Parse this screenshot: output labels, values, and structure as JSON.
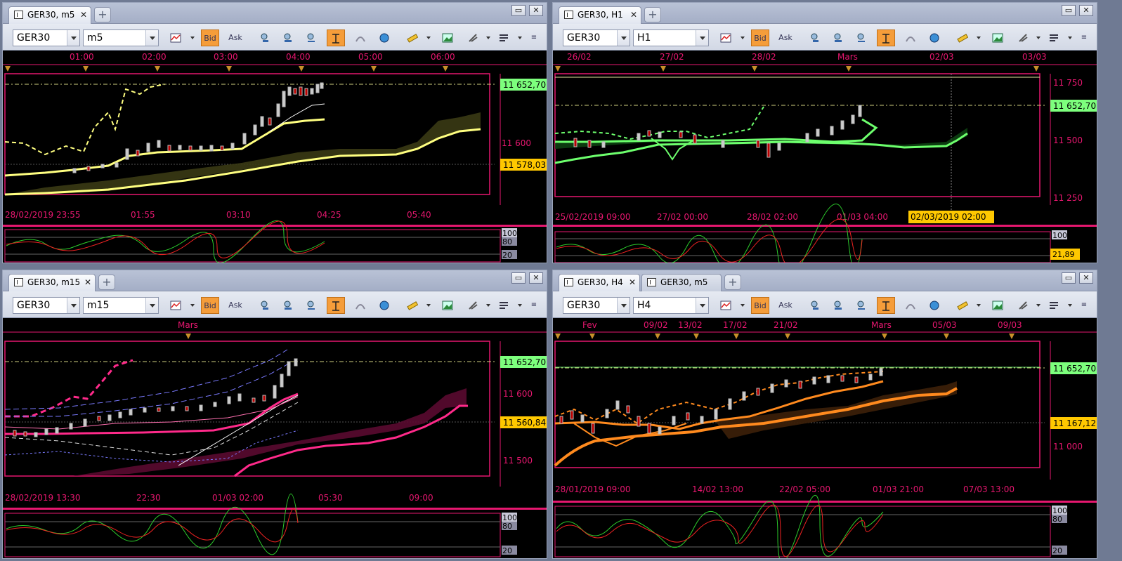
{
  "windows": [
    {
      "id": "w1",
      "tabs": [
        {
          "label": "GER30, m5",
          "active": true
        }
      ],
      "symbol": "GER30",
      "timeframe": "m5",
      "toolbar": {
        "bid": "Bid",
        "ask": "Ask"
      },
      "top_axis": [
        "01:00",
        "02:00",
        "03:00",
        "04:00",
        "05:00",
        "06:00"
      ],
      "price_labels": [
        "11 600"
      ],
      "badges": [
        {
          "text": "11 652,70",
          "color": "#7dff7d"
        },
        {
          "text": "11 578,03",
          "color": "#ffc800"
        }
      ],
      "bottom_axis": [
        "28/02/2019 23:55",
        "01:55",
        "03:10",
        "04:25",
        "05:40"
      ],
      "osc_labels": [
        "100",
        "80",
        "20"
      ]
    },
    {
      "id": "w2",
      "tabs": [
        {
          "label": "GER30, H1",
          "active": true
        }
      ],
      "symbol": "GER30",
      "timeframe": "H1",
      "toolbar": {
        "bid": "Bid",
        "ask": "Ask"
      },
      "top_axis": [
        "26/02",
        "27/02",
        "28/02",
        "Mars",
        "02/03",
        "03/03"
      ],
      "price_labels": [
        "11 750",
        "11 500",
        "11 250"
      ],
      "badges": [
        {
          "text": "11 652,70",
          "color": "#7dff7d"
        }
      ],
      "bottom_axis": [
        "25/02/2019 09:00",
        "27/02 00:00",
        "28/02 02:00",
        "01/03 04:00"
      ],
      "crosshair_label": "02/03/2019 02:00",
      "osc_labels": [
        "100"
      ],
      "osc_badge": "21,89"
    },
    {
      "id": "w3",
      "tabs": [
        {
          "label": "GER30, m15",
          "active": true
        }
      ],
      "symbol": "GER30",
      "timeframe": "m15",
      "toolbar": {
        "bid": "Bid",
        "ask": "Ask"
      },
      "top_axis": [
        "Mars"
      ],
      "price_labels": [
        "11 600",
        "11 500"
      ],
      "badges": [
        {
          "text": "11 652,70",
          "color": "#7dff7d"
        },
        {
          "text": "11 560,84",
          "color": "#ffc800"
        }
      ],
      "bottom_axis": [
        "28/02/2019 13:30",
        "22:30",
        "01/03 02:00",
        "05:30",
        "09:00"
      ],
      "osc_labels": [
        "100",
        "80",
        "20"
      ]
    },
    {
      "id": "w4",
      "tabs": [
        {
          "label": "GER30, H4",
          "active": true
        },
        {
          "label": "GER30, m5",
          "active": false
        }
      ],
      "symbol": "GER30",
      "timeframe": "H4",
      "toolbar": {
        "bid": "Bid",
        "ask": "Ask"
      },
      "top_axis": [
        "Fev",
        "09/02",
        "13/02",
        "17/02",
        "21/02",
        "Mars",
        "05/03",
        "09/03"
      ],
      "price_labels": [
        "11 000"
      ],
      "badges": [
        {
          "text": "11 652,70",
          "color": "#7dff7d"
        },
        {
          "text": "11 167,12",
          "color": "#ffc800"
        }
      ],
      "bottom_axis": [
        "28/01/2019 09:00",
        "14/02 13:00",
        "22/02 05:00",
        "01/03 21:00",
        "07/03 13:00"
      ],
      "osc_labels": [
        "100",
        "80",
        "20"
      ]
    }
  ],
  "colors": {
    "frame": "#e6176f",
    "axis_text": "#e6176f",
    "bid_active": "#f59d3a"
  }
}
